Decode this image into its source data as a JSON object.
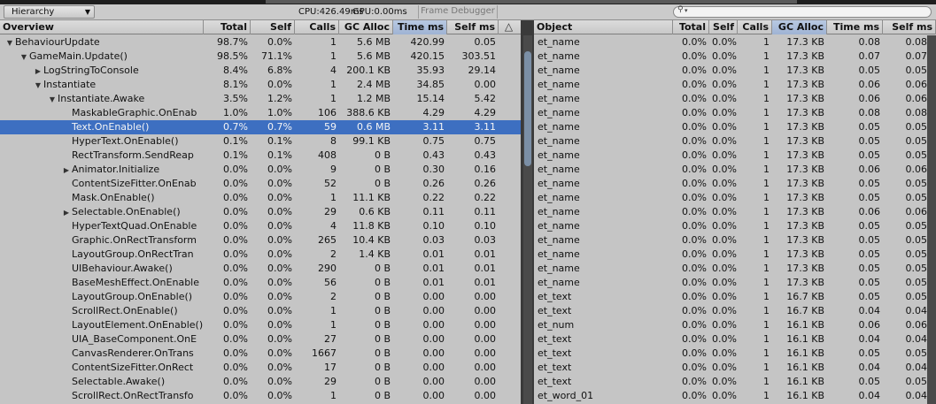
{
  "toolbar": {
    "view_dropdown": "Hierarchy",
    "cpu": "CPU:426.49ms",
    "gpu": "GPU:0.00ms",
    "frame_debugger": "Frame Debugger",
    "search_placeholder": ""
  },
  "left_columns": [
    "Overview",
    "Total",
    "Self",
    "Calls",
    "GC Alloc",
    "Time ms",
    "Self ms"
  ],
  "right_columns": [
    "Object",
    "Total",
    "Self",
    "Calls",
    "GC Alloc",
    "Time ms",
    "Self ms"
  ],
  "left_rows": [
    {
      "indent": 0,
      "exp": "open",
      "name": "BehaviourUpdate",
      "total": "98.7%",
      "self": "0.0%",
      "calls": "1",
      "gc": "5.6 MB",
      "time": "420.99",
      "selfms": "0.05"
    },
    {
      "indent": 1,
      "exp": "open",
      "name": "GameMain.Update()",
      "total": "98.5%",
      "self": "71.1%",
      "calls": "1",
      "gc": "5.6 MB",
      "time": "420.15",
      "selfms": "303.51"
    },
    {
      "indent": 2,
      "exp": "closed",
      "name": "LogStringToConsole",
      "total": "8.4%",
      "self": "6.8%",
      "calls": "4",
      "gc": "200.1 KB",
      "time": "35.93",
      "selfms": "29.14"
    },
    {
      "indent": 2,
      "exp": "open",
      "name": "Instantiate",
      "total": "8.1%",
      "self": "0.0%",
      "calls": "1",
      "gc": "2.4 MB",
      "time": "34.85",
      "selfms": "0.00"
    },
    {
      "indent": 3,
      "exp": "open",
      "name": "Instantiate.Awake",
      "total": "3.5%",
      "self": "1.2%",
      "calls": "1",
      "gc": "1.2 MB",
      "time": "15.14",
      "selfms": "5.42"
    },
    {
      "indent": 4,
      "exp": "none",
      "name": "MaskableGraphic.OnEnab",
      "total": "1.0%",
      "self": "1.0%",
      "calls": "106",
      "gc": "388.6 KB",
      "time": "4.29",
      "selfms": "4.29"
    },
    {
      "indent": 4,
      "exp": "none",
      "name": "Text.OnEnable()",
      "total": "0.7%",
      "self": "0.7%",
      "calls": "59",
      "gc": "0.6 MB",
      "time": "3.11",
      "selfms": "3.11",
      "selected": true
    },
    {
      "indent": 4,
      "exp": "none",
      "name": "HyperText.OnEnable()",
      "total": "0.1%",
      "self": "0.1%",
      "calls": "8",
      "gc": "99.1 KB",
      "time": "0.75",
      "selfms": "0.75"
    },
    {
      "indent": 4,
      "exp": "none",
      "name": "RectTransform.SendReap",
      "total": "0.1%",
      "self": "0.1%",
      "calls": "408",
      "gc": "0 B",
      "time": "0.43",
      "selfms": "0.43"
    },
    {
      "indent": 4,
      "exp": "closed",
      "name": "Animator.Initialize",
      "total": "0.0%",
      "self": "0.0%",
      "calls": "9",
      "gc": "0 B",
      "time": "0.30",
      "selfms": "0.16"
    },
    {
      "indent": 4,
      "exp": "none",
      "name": "ContentSizeFitter.OnEnab",
      "total": "0.0%",
      "self": "0.0%",
      "calls": "52",
      "gc": "0 B",
      "time": "0.26",
      "selfms": "0.26"
    },
    {
      "indent": 4,
      "exp": "none",
      "name": "Mask.OnEnable()",
      "total": "0.0%",
      "self": "0.0%",
      "calls": "1",
      "gc": "11.1 KB",
      "time": "0.22",
      "selfms": "0.22"
    },
    {
      "indent": 4,
      "exp": "closed",
      "name": "Selectable.OnEnable()",
      "total": "0.0%",
      "self": "0.0%",
      "calls": "29",
      "gc": "0.6 KB",
      "time": "0.11",
      "selfms": "0.11"
    },
    {
      "indent": 4,
      "exp": "none",
      "name": "HyperTextQuad.OnEnable",
      "total": "0.0%",
      "self": "0.0%",
      "calls": "4",
      "gc": "11.8 KB",
      "time": "0.10",
      "selfms": "0.10"
    },
    {
      "indent": 4,
      "exp": "none",
      "name": "Graphic.OnRectTransform",
      "total": "0.0%",
      "self": "0.0%",
      "calls": "265",
      "gc": "10.4 KB",
      "time": "0.03",
      "selfms": "0.03"
    },
    {
      "indent": 4,
      "exp": "none",
      "name": "LayoutGroup.OnRectTran",
      "total": "0.0%",
      "self": "0.0%",
      "calls": "2",
      "gc": "1.4 KB",
      "time": "0.01",
      "selfms": "0.01"
    },
    {
      "indent": 4,
      "exp": "none",
      "name": "UIBehaviour.Awake()",
      "total": "0.0%",
      "self": "0.0%",
      "calls": "290",
      "gc": "0 B",
      "time": "0.01",
      "selfms": "0.01"
    },
    {
      "indent": 4,
      "exp": "none",
      "name": "BaseMeshEffect.OnEnable",
      "total": "0.0%",
      "self": "0.0%",
      "calls": "56",
      "gc": "0 B",
      "time": "0.01",
      "selfms": "0.01"
    },
    {
      "indent": 4,
      "exp": "none",
      "name": "LayoutGroup.OnEnable()",
      "total": "0.0%",
      "self": "0.0%",
      "calls": "2",
      "gc": "0 B",
      "time": "0.00",
      "selfms": "0.00"
    },
    {
      "indent": 4,
      "exp": "none",
      "name": "ScrollRect.OnEnable()",
      "total": "0.0%",
      "self": "0.0%",
      "calls": "1",
      "gc": "0 B",
      "time": "0.00",
      "selfms": "0.00"
    },
    {
      "indent": 4,
      "exp": "none",
      "name": "LayoutElement.OnEnable()",
      "total": "0.0%",
      "self": "0.0%",
      "calls": "1",
      "gc": "0 B",
      "time": "0.00",
      "selfms": "0.00"
    },
    {
      "indent": 4,
      "exp": "none",
      "name": "UIA_BaseComponent.OnE",
      "total": "0.0%",
      "self": "0.0%",
      "calls": "27",
      "gc": "0 B",
      "time": "0.00",
      "selfms": "0.00"
    },
    {
      "indent": 4,
      "exp": "none",
      "name": "CanvasRenderer.OnTrans",
      "total": "0.0%",
      "self": "0.0%",
      "calls": "1667",
      "gc": "0 B",
      "time": "0.00",
      "selfms": "0.00"
    },
    {
      "indent": 4,
      "exp": "none",
      "name": "ContentSizeFitter.OnRect",
      "total": "0.0%",
      "self": "0.0%",
      "calls": "17",
      "gc": "0 B",
      "time": "0.00",
      "selfms": "0.00"
    },
    {
      "indent": 4,
      "exp": "none",
      "name": "Selectable.Awake()",
      "total": "0.0%",
      "self": "0.0%",
      "calls": "29",
      "gc": "0 B",
      "time": "0.00",
      "selfms": "0.00"
    },
    {
      "indent": 4,
      "exp": "none",
      "name": "ScrollRect.OnRectTransfo",
      "total": "0.0%",
      "self": "0.0%",
      "calls": "1",
      "gc": "0 B",
      "time": "0.00",
      "selfms": "0.00"
    }
  ],
  "right_rows": [
    {
      "name": "et_name",
      "total": "0.0%",
      "self": "0.0%",
      "calls": "1",
      "gc": "17.3 KB",
      "time": "0.08",
      "selfms": "0.08"
    },
    {
      "name": "et_name",
      "total": "0.0%",
      "self": "0.0%",
      "calls": "1",
      "gc": "17.3 KB",
      "time": "0.07",
      "selfms": "0.07"
    },
    {
      "name": "et_name",
      "total": "0.0%",
      "self": "0.0%",
      "calls": "1",
      "gc": "17.3 KB",
      "time": "0.05",
      "selfms": "0.05"
    },
    {
      "name": "et_name",
      "total": "0.0%",
      "self": "0.0%",
      "calls": "1",
      "gc": "17.3 KB",
      "time": "0.06",
      "selfms": "0.06"
    },
    {
      "name": "et_name",
      "total": "0.0%",
      "self": "0.0%",
      "calls": "1",
      "gc": "17.3 KB",
      "time": "0.06",
      "selfms": "0.06"
    },
    {
      "name": "et_name",
      "total": "0.0%",
      "self": "0.0%",
      "calls": "1",
      "gc": "17.3 KB",
      "time": "0.08",
      "selfms": "0.08"
    },
    {
      "name": "et_name",
      "total": "0.0%",
      "self": "0.0%",
      "calls": "1",
      "gc": "17.3 KB",
      "time": "0.05",
      "selfms": "0.05"
    },
    {
      "name": "et_name",
      "total": "0.0%",
      "self": "0.0%",
      "calls": "1",
      "gc": "17.3 KB",
      "time": "0.05",
      "selfms": "0.05"
    },
    {
      "name": "et_name",
      "total": "0.0%",
      "self": "0.0%",
      "calls": "1",
      "gc": "17.3 KB",
      "time": "0.05",
      "selfms": "0.05"
    },
    {
      "name": "et_name",
      "total": "0.0%",
      "self": "0.0%",
      "calls": "1",
      "gc": "17.3 KB",
      "time": "0.06",
      "selfms": "0.06"
    },
    {
      "name": "et_name",
      "total": "0.0%",
      "self": "0.0%",
      "calls": "1",
      "gc": "17.3 KB",
      "time": "0.05",
      "selfms": "0.05"
    },
    {
      "name": "et_name",
      "total": "0.0%",
      "self": "0.0%",
      "calls": "1",
      "gc": "17.3 KB",
      "time": "0.05",
      "selfms": "0.05"
    },
    {
      "name": "et_name",
      "total": "0.0%",
      "self": "0.0%",
      "calls": "1",
      "gc": "17.3 KB",
      "time": "0.06",
      "selfms": "0.06"
    },
    {
      "name": "et_name",
      "total": "0.0%",
      "self": "0.0%",
      "calls": "1",
      "gc": "17.3 KB",
      "time": "0.05",
      "selfms": "0.05"
    },
    {
      "name": "et_name",
      "total": "0.0%",
      "self": "0.0%",
      "calls": "1",
      "gc": "17.3 KB",
      "time": "0.05",
      "selfms": "0.05"
    },
    {
      "name": "et_name",
      "total": "0.0%",
      "self": "0.0%",
      "calls": "1",
      "gc": "17.3 KB",
      "time": "0.05",
      "selfms": "0.05"
    },
    {
      "name": "et_name",
      "total": "0.0%",
      "self": "0.0%",
      "calls": "1",
      "gc": "17.3 KB",
      "time": "0.05",
      "selfms": "0.05"
    },
    {
      "name": "et_name",
      "total": "0.0%",
      "self": "0.0%",
      "calls": "1",
      "gc": "17.3 KB",
      "time": "0.05",
      "selfms": "0.05"
    },
    {
      "name": "et_text",
      "total": "0.0%",
      "self": "0.0%",
      "calls": "1",
      "gc": "16.7 KB",
      "time": "0.05",
      "selfms": "0.05"
    },
    {
      "name": "et_text",
      "total": "0.0%",
      "self": "0.0%",
      "calls": "1",
      "gc": "16.7 KB",
      "time": "0.04",
      "selfms": "0.04"
    },
    {
      "name": "et_num",
      "total": "0.0%",
      "self": "0.0%",
      "calls": "1",
      "gc": "16.1 KB",
      "time": "0.06",
      "selfms": "0.06"
    },
    {
      "name": "et_text",
      "total": "0.0%",
      "self": "0.0%",
      "calls": "1",
      "gc": "16.1 KB",
      "time": "0.04",
      "selfms": "0.04"
    },
    {
      "name": "et_text",
      "total": "0.0%",
      "self": "0.0%",
      "calls": "1",
      "gc": "16.1 KB",
      "time": "0.05",
      "selfms": "0.05"
    },
    {
      "name": "et_text",
      "total": "0.0%",
      "self": "0.0%",
      "calls": "1",
      "gc": "16.1 KB",
      "time": "0.04",
      "selfms": "0.04"
    },
    {
      "name": "et_text",
      "total": "0.0%",
      "self": "0.0%",
      "calls": "1",
      "gc": "16.1 KB",
      "time": "0.05",
      "selfms": "0.05"
    },
    {
      "name": "et_word_01",
      "total": "0.0%",
      "self": "0.0%",
      "calls": "1",
      "gc": "16.1 KB",
      "time": "0.04",
      "selfms": "0.04"
    }
  ],
  "colors": {
    "selection": "#3d6fc1",
    "sorted_header": "#b8c9e2",
    "panel": "#c5c5c5",
    "scrollbar_thumb": "#7b8fa6"
  },
  "icons": {
    "expanded": "triangle-down-icon",
    "collapsed": "triangle-right-icon",
    "search": "magnifier-icon",
    "warning": "warning-triangle-icon"
  }
}
